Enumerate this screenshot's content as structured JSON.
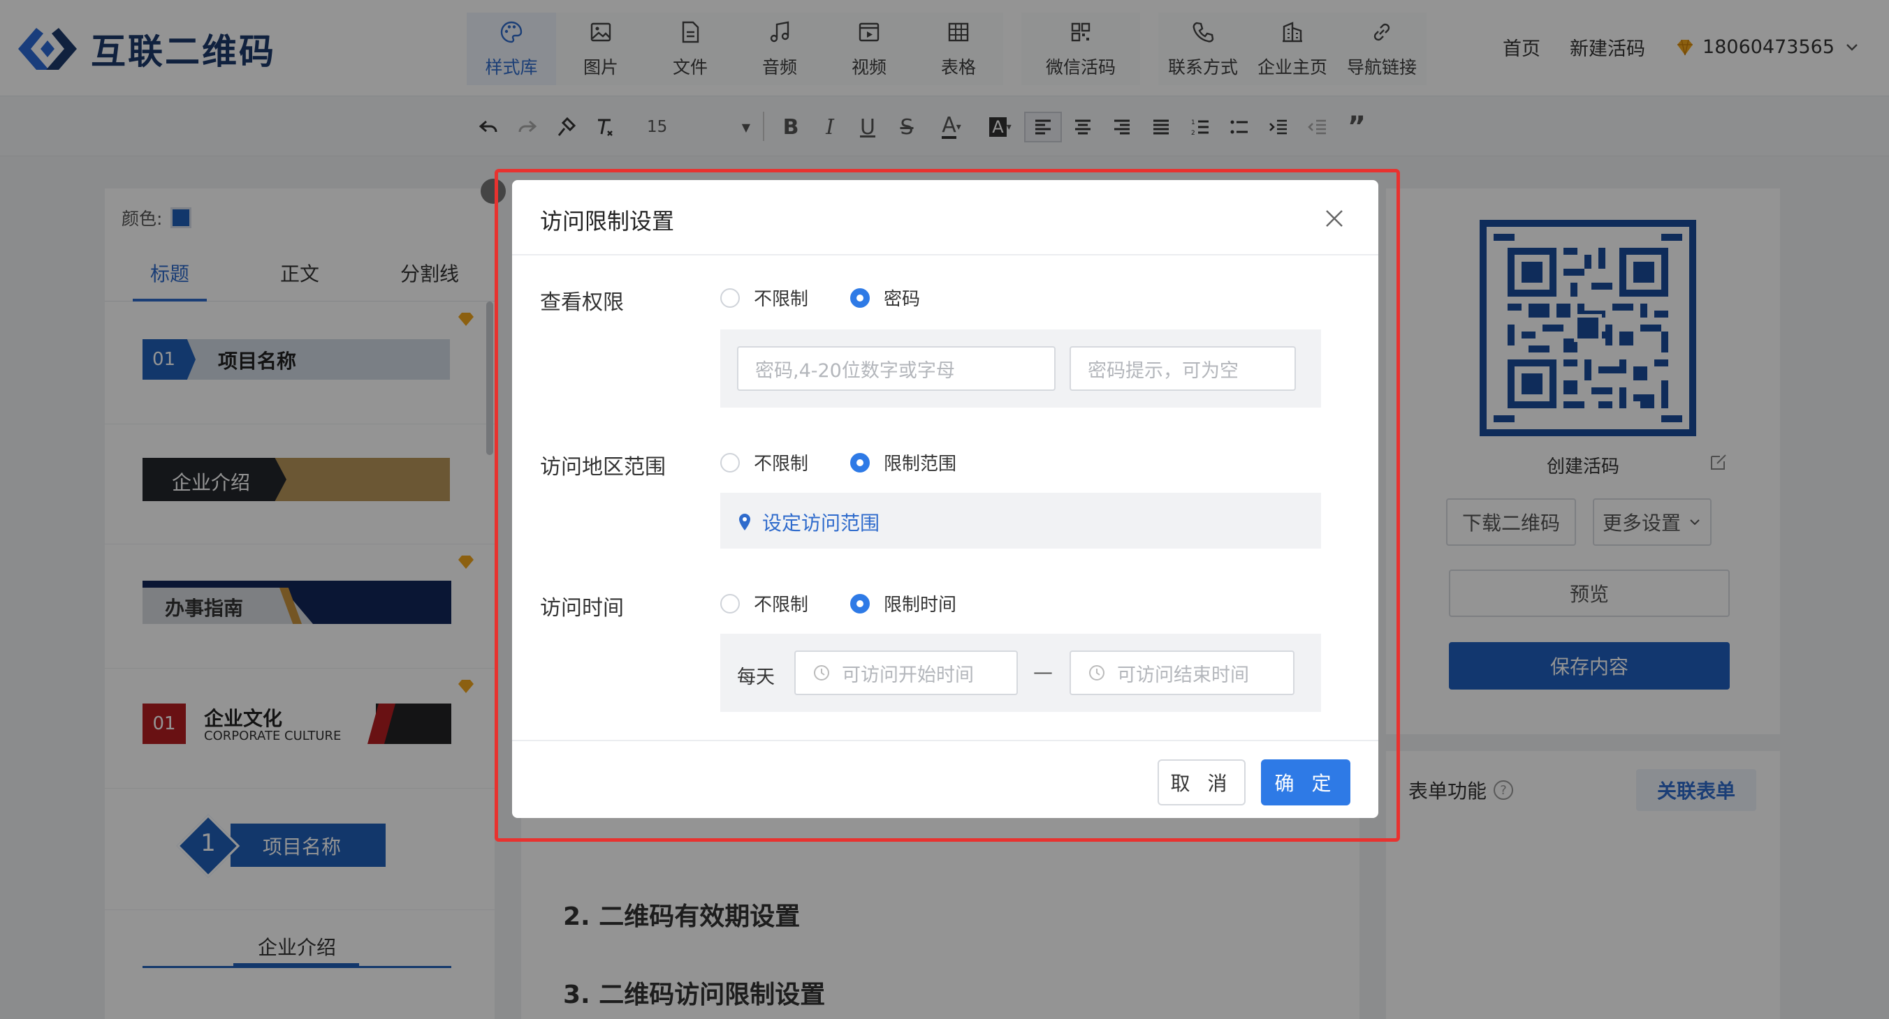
{
  "header": {
    "logo_text": "互联二维码",
    "tools": [
      {
        "label": "样式库",
        "icon": "palette-icon"
      },
      {
        "label": "图片",
        "icon": "image-icon"
      },
      {
        "label": "文件",
        "icon": "file-icon"
      },
      {
        "label": "音频",
        "icon": "music-icon"
      },
      {
        "label": "视频",
        "icon": "video-icon"
      },
      {
        "label": "表格",
        "icon": "table-icon"
      },
      {
        "label": "微信活码",
        "icon": "qr-grid-icon"
      },
      {
        "label": "联系方式",
        "icon": "phone-icon"
      },
      {
        "label": "企业主页",
        "icon": "building-icon"
      },
      {
        "label": "导航链接",
        "icon": "link-icon"
      }
    ],
    "nav": {
      "home": "首页",
      "new_code": "新建活码",
      "phone": "18060473565"
    }
  },
  "toolbar": {
    "font_size": "15"
  },
  "left_panel": {
    "color_label": "颜色:",
    "tabs": [
      "标题",
      "正文",
      "分割线"
    ],
    "items": [
      {
        "num": "01",
        "text": "项目名称"
      },
      {
        "text": "企业介绍"
      },
      {
        "text": "办事指南"
      },
      {
        "num": "01",
        "text": "企业文化",
        "sub": "CORPORATE CULTURE"
      },
      {
        "num": "1",
        "text": "项目名称"
      },
      {
        "text": "企业介绍"
      }
    ]
  },
  "doc": {
    "h2": "2. 二维码有效期设置",
    "h3": "3. 二维码访问限制设置"
  },
  "right_panel": {
    "qr_caption": "创建活码",
    "download": "下载二维码",
    "more": "更多设置",
    "preview": "预览",
    "save": "保存内容",
    "form_label": "表单功能",
    "link_form": "关联表单"
  },
  "modal": {
    "title": "访问限制设置",
    "view": {
      "label": "查看权限",
      "opt_none": "不限制",
      "opt_pw": "密码",
      "pw_placeholder": "密码,4-20位数字或字母",
      "hint_placeholder": "密码提示，可为空"
    },
    "region": {
      "label": "访问地区范围",
      "opt_none": "不限制",
      "opt_limit": "限制范围",
      "set_range": "设定访问范围"
    },
    "time": {
      "label": "访问时间",
      "opt_none": "不限制",
      "opt_limit": "限制时间",
      "daily": "每天",
      "start_placeholder": "可访问开始时间",
      "dash": "—",
      "end_placeholder": "可访问结束时间"
    },
    "cancel": "取 消",
    "ok": "确 定"
  },
  "colors": {
    "accent": "#2e7ae6",
    "brand": "#1d3a6b",
    "highlight": "#e8322f"
  }
}
